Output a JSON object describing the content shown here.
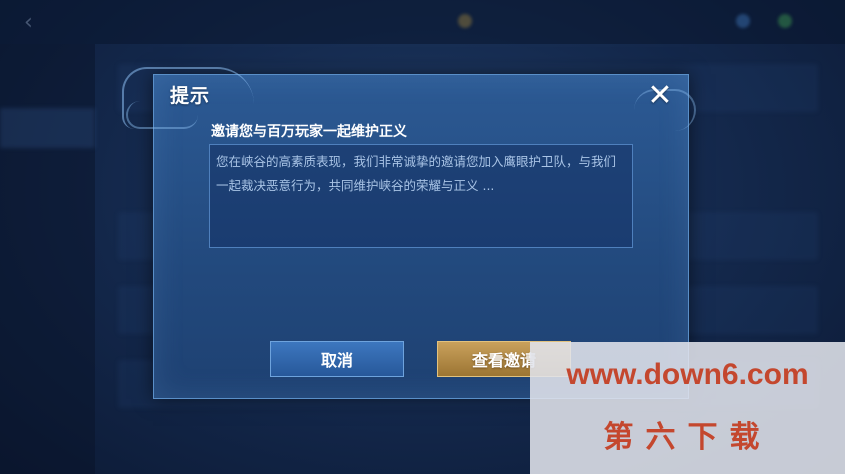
{
  "dialog": {
    "title": "提示",
    "close_icon": "close-icon",
    "message_title": "邀请您与百万玩家一起维护正义",
    "message_body": "您在峡谷的高素质表现，我们非常诚挚的邀请您加入鹰眼护卫队，与我们一起裁决恶意行为，共同维护峡谷的荣耀与正义 ...",
    "cancel_label": "取消",
    "view_invite_label": "查看邀请"
  },
  "watermark": {
    "url": "www.down6.com",
    "name": "第六下载"
  },
  "colors": {
    "dialog_bg": "#2c5a94",
    "cancel_button": "#3d77bf",
    "view_button": "#c9a15c",
    "watermark_text": "#c4472e"
  }
}
